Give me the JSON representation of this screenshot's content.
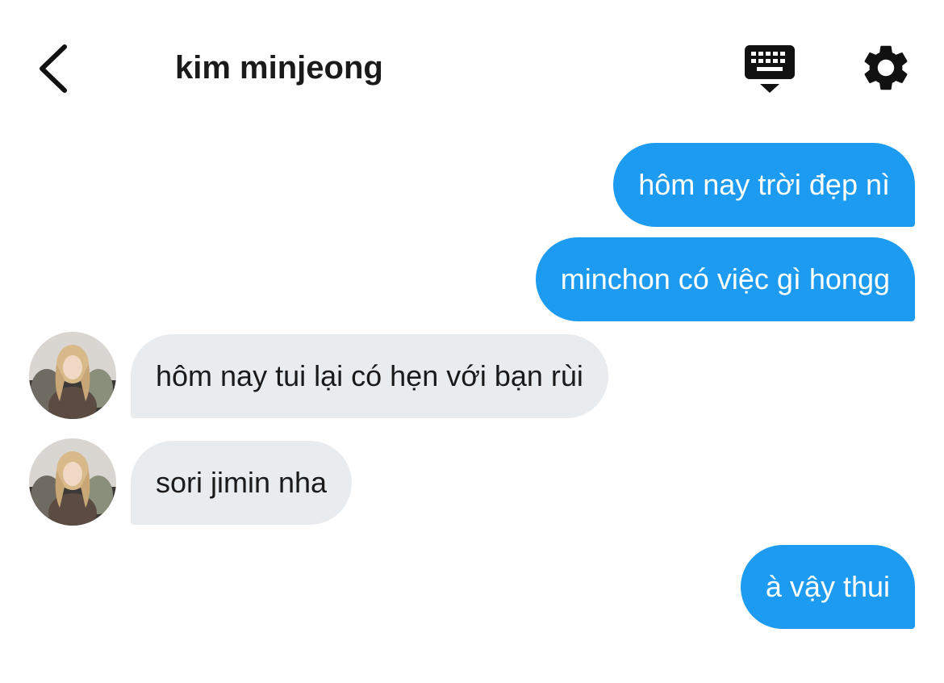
{
  "header": {
    "title": "kim minjeong",
    "back_icon": "chevron-left-icon",
    "keyboard_icon": "keyboard-hide-icon",
    "settings_icon": "gear-icon"
  },
  "messages": [
    {
      "direction": "outgoing",
      "text": "hôm nay trời đẹp nì"
    },
    {
      "direction": "outgoing",
      "text": "minchon có việc gì hongg"
    },
    {
      "direction": "incoming",
      "text": "hôm nay tui lại có hẹn với bạn rùi"
    },
    {
      "direction": "incoming",
      "text": "sori jimin nha"
    },
    {
      "direction": "outgoing",
      "text": "à vậy thui"
    }
  ],
  "colors": {
    "outgoing_bubble": "#1d9bf0",
    "incoming_bubble": "#e9ecef",
    "text_dark": "#1a1a1a",
    "text_light": "#ffffff"
  }
}
